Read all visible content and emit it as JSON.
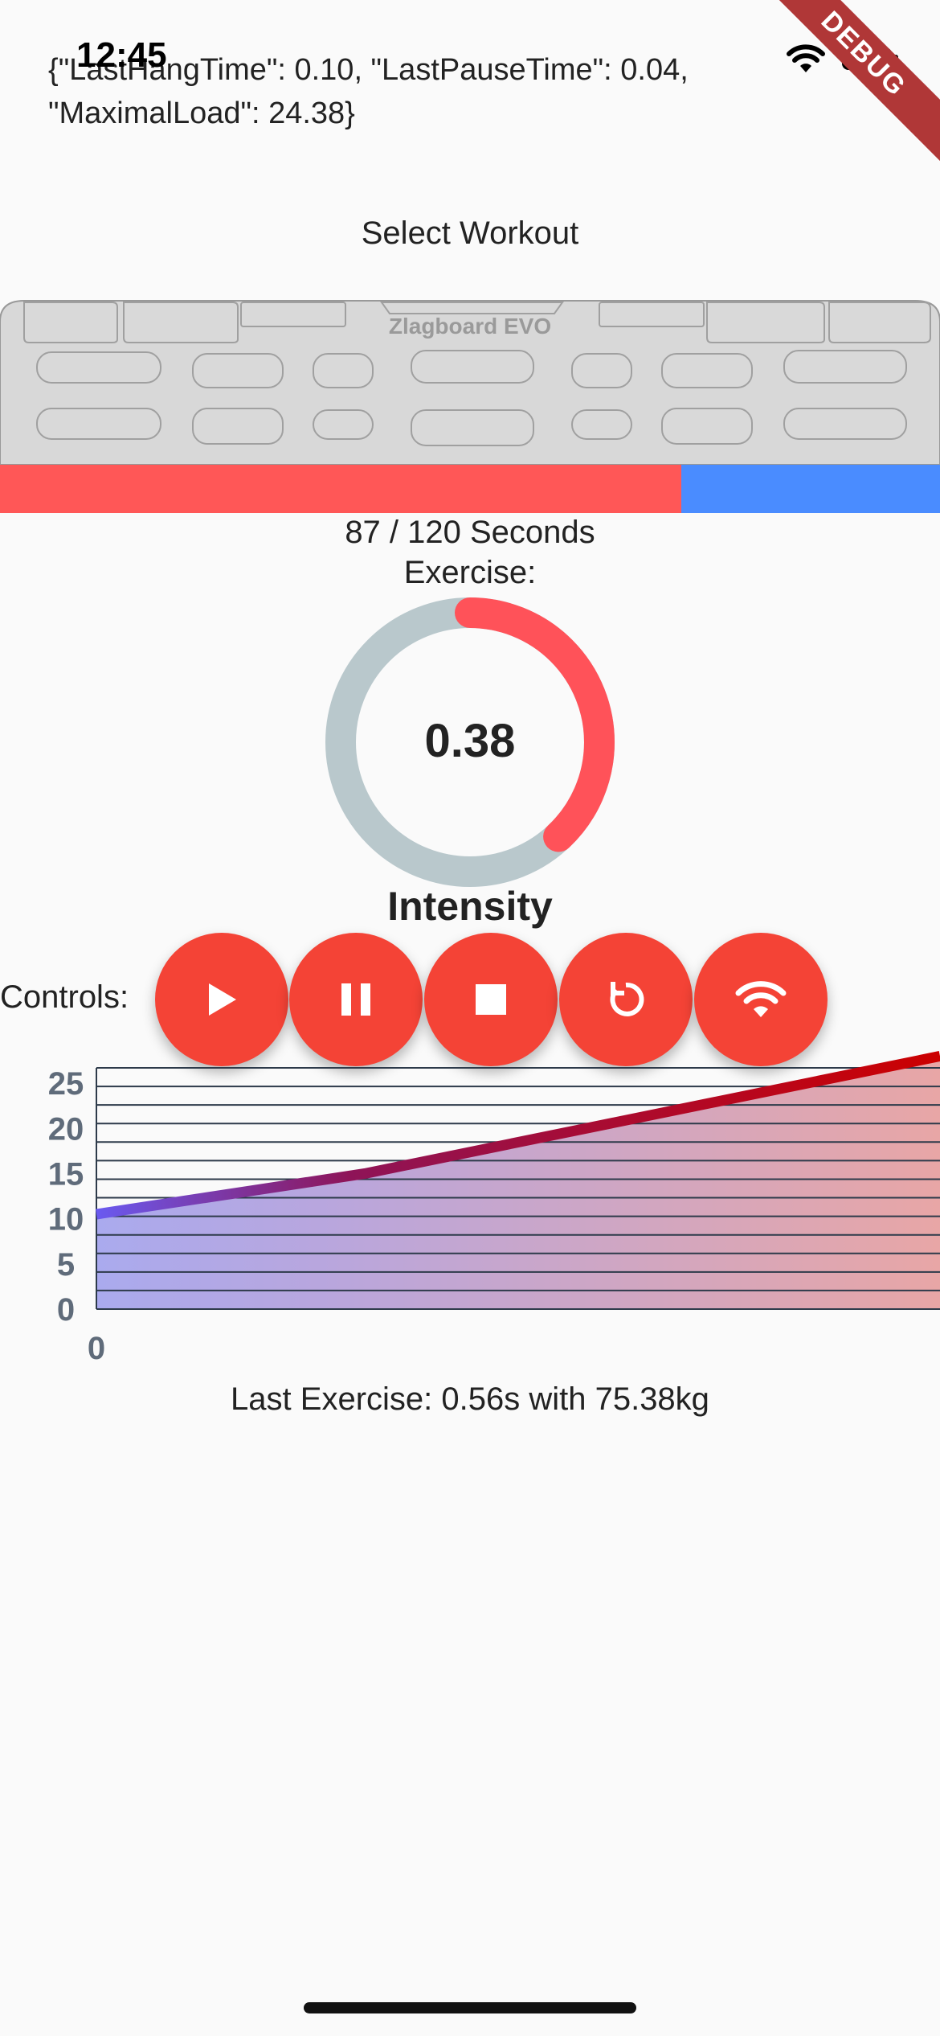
{
  "status_bar": {
    "time": "12:45",
    "wifi_icon": "wifi-icon",
    "battery_icon": "battery-icon"
  },
  "debug_banner": "DEBUG",
  "json_output": {
    "line1": "{\"LastHangTime\": 0.10, \"LastPauseTime\": 0.04,",
    "line2": "\"MaximalLoad\": 24.38}"
  },
  "select_workout": "Select Workout",
  "hangboard": {
    "label": "Zlagboard EVO"
  },
  "progress": {
    "elapsed": 87,
    "total": 120,
    "fraction": 0.725,
    "fill_color": "#ff5757",
    "track_color": "#4a8cff",
    "text": "87 / 120 Seconds"
  },
  "exercise_label": "Exercise:",
  "gauge": {
    "value_text": "0.38",
    "fraction": 0.38,
    "arc_color": "#ff5259",
    "track_color": "#b9c8cc"
  },
  "intensity_label": "Intensity",
  "controls": {
    "label": "Controls:",
    "color": "#f44336",
    "buttons": [
      {
        "name": "play-button",
        "icon": "play-icon"
      },
      {
        "name": "pause-button",
        "icon": "pause-icon"
      },
      {
        "name": "stop-button",
        "icon": "stop-icon"
      },
      {
        "name": "reset-button",
        "icon": "reset-icon"
      },
      {
        "name": "connect-button",
        "icon": "wifi-icon"
      }
    ]
  },
  "chart_data": {
    "type": "area",
    "x": [
      0,
      4.2,
      13.2
    ],
    "y": [
      10.5,
      15,
      28
    ],
    "xlim": [
      0,
      13.2
    ],
    "ylim": [
      0,
      26.7
    ],
    "yticks": [
      "0",
      "5",
      "10",
      "15",
      "20",
      "25"
    ],
    "xticks": [
      "0"
    ],
    "grid": true,
    "line_color_start": "#6a5af0",
    "line_color_end": "#cc0000",
    "fill_color_start": "#aaaaee",
    "fill_color_end": "#e8a6a6"
  },
  "last_exercise": "Last Exercise: 0.56s with 75.38kg"
}
